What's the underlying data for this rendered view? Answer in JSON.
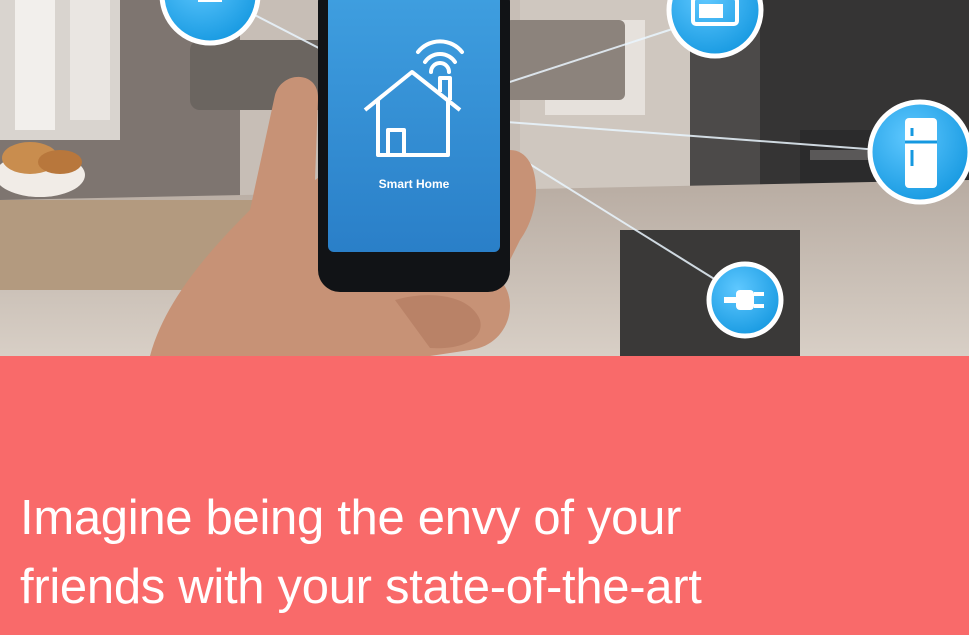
{
  "phone": {
    "screen_label": "Smart Home"
  },
  "icons": {
    "phone": "smart-home-house-wifi-icon",
    "appliances": [
      "small-device-icon",
      "microwave-icon",
      "refrigerator-icon",
      "power-plug-icon"
    ]
  },
  "headline": {
    "lines": [
      "Imagine being the envy of your",
      "friends with your state-of-the-art"
    ]
  },
  "colors": {
    "panel": "#f96a6a",
    "icon_blue": "#1fa6e8",
    "phone_screen": "#2e8fd6",
    "text": "#ffffff"
  }
}
